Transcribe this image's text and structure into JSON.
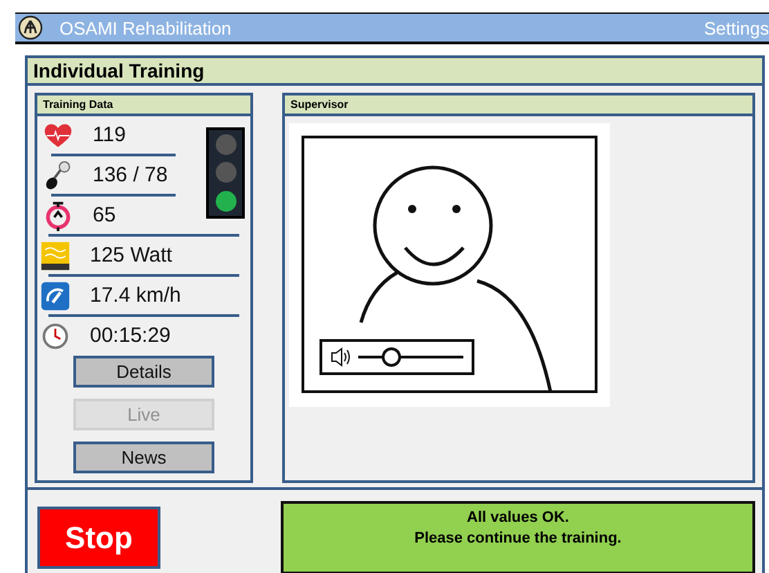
{
  "app_bar": {
    "title": "OSAMI Rehabilitation",
    "settings": "Settings"
  },
  "page": {
    "title": "Individual Training"
  },
  "training_data": {
    "title": "Training Data",
    "metrics": [
      {
        "kind": "heart",
        "value": "119"
      },
      {
        "kind": "pressure",
        "value": "136 / 78"
      },
      {
        "kind": "pulse",
        "value": "65"
      },
      {
        "kind": "energy",
        "value": "125 Watt"
      },
      {
        "kind": "speed",
        "value": "17.4 km/h"
      },
      {
        "kind": "time",
        "value": "00:15:29"
      }
    ],
    "traffic_light": [
      {
        "on": false
      },
      {
        "on": false
      },
      {
        "on": true
      }
    ],
    "buttons": [
      {
        "label": "Details",
        "disabled": false
      },
      {
        "label": "Live",
        "disabled": true
      },
      {
        "label": "News",
        "disabled": false
      }
    ]
  },
  "supervisor": {
    "title": "Supervisor",
    "volume": {
      "level": 0.3
    }
  },
  "stop_button": "Stop",
  "message": [
    "All values OK.",
    "Please continue the training."
  ]
}
